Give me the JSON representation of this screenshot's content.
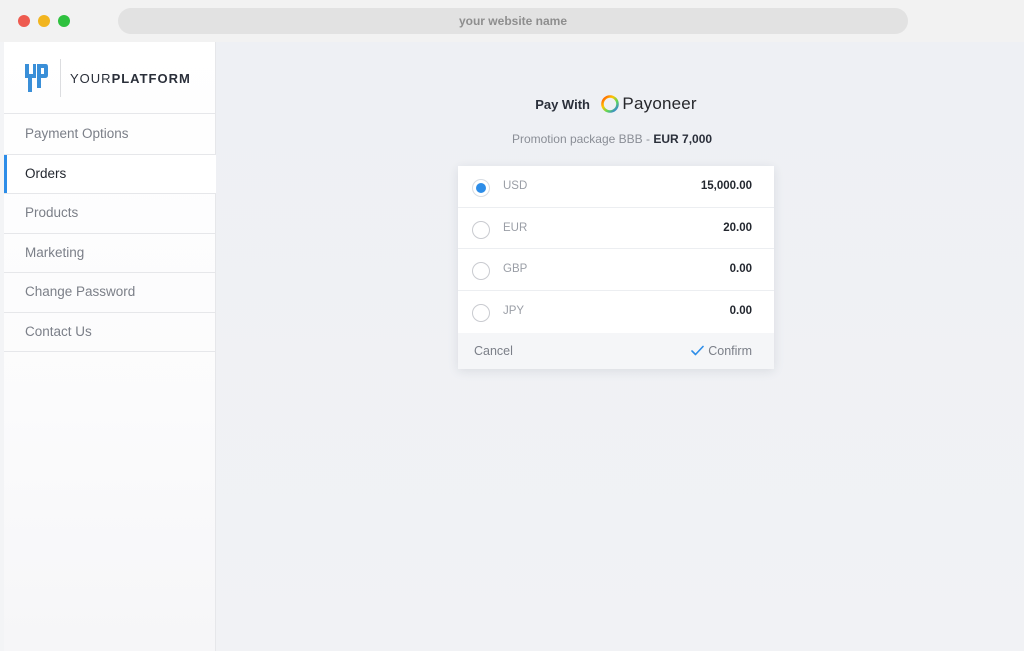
{
  "browser": {
    "url": "your website name"
  },
  "brand": {
    "logo_text_light": "YOUR",
    "logo_text_bold": "PLATFORM"
  },
  "sidebar": {
    "items": [
      {
        "label": "Payment Options",
        "active": false
      },
      {
        "label": "Orders",
        "active": true
      },
      {
        "label": "Products",
        "active": false
      },
      {
        "label": "Marketing",
        "active": false
      },
      {
        "label": "Change Password",
        "active": false
      },
      {
        "label": "Contact Us",
        "active": false
      }
    ]
  },
  "payment": {
    "pay_with_label": "Pay With",
    "provider_name": "Payoneer",
    "promo_text": "Promotion package BBB - ",
    "promo_price": "EUR 7,000",
    "currencies": [
      {
        "code": "USD",
        "amount": "15,000.00",
        "selected": true
      },
      {
        "code": "EUR",
        "amount": "20.00",
        "selected": false
      },
      {
        "code": "GBP",
        "amount": "0.00",
        "selected": false
      },
      {
        "code": "JPY",
        "amount": "0.00",
        "selected": false
      }
    ],
    "cancel_label": "Cancel",
    "confirm_label": "Confirm"
  },
  "colors": {
    "accent": "#2d8de8",
    "traffic_red": "#ee5b50",
    "traffic_yellow": "#f2b51f",
    "traffic_green": "#2fc13f"
  }
}
